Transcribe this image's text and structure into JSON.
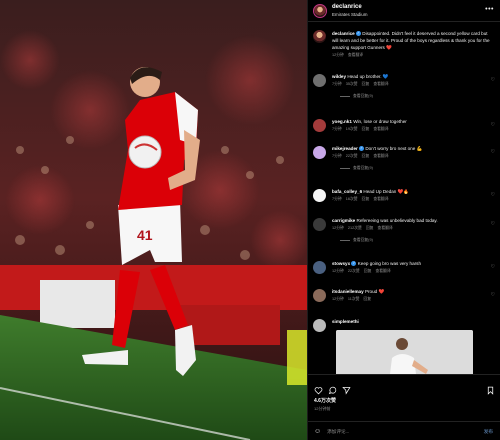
{
  "post": {
    "username": "declanrice",
    "location": "Emirates Stadium",
    "caption_user": "declanrice",
    "caption_text": "Disappointed. Didn't feel it deserved a second yellow card but will learn and be better for it. Proud of the boys regardless & thank you for the amazing support Gunners ❤️",
    "caption_time": "12分钟",
    "caption_translate": "查看翻译",
    "player_number": "41"
  },
  "comments": [
    {
      "user": "wildey",
      "text": "Head up brother. 💙",
      "time": "7分钟",
      "likes": "35次赞",
      "reply": "回复",
      "translate": "查看翻译",
      "view_replies": "查看回复(9)",
      "avatar_color": "#6f6f6f"
    },
    {
      "user": "yoeg.nk1",
      "text": "Win, lose or draw together",
      "time": "7分钟",
      "likes": "19次赞",
      "reply": "回复",
      "translate": "查看翻译",
      "view_replies": "",
      "avatar_color": "#a33b3b"
    },
    {
      "user": "mikejreader",
      "text": "Don't worry bro next one 💪",
      "time": "7分钟",
      "likes": "22次赞",
      "reply": "回复",
      "translate": "查看翻译",
      "view_replies": "查看回复(9)",
      "avatar_color": "#c8a8e8"
    },
    {
      "user": "bafa_colley_6",
      "text": "Head Up Dedan ❤️🔥",
      "time": "7分钟",
      "likes": "16次赞",
      "reply": "回复",
      "translate": "查看翻译",
      "view_replies": "",
      "avatar_color": "#f4f4f4"
    },
    {
      "user": "carrigmike",
      "text": "Refereeing was unbelievably bad today.",
      "time": "12分钟",
      "likes": "212次赞",
      "reply": "回复",
      "translate": "查看翻译",
      "view_replies": "查看回复(9)",
      "avatar_color": "#3a3a3a"
    },
    {
      "user": "stowsyx",
      "text": "Keep going bro was very harsh",
      "time": "12分钟",
      "likes": "22次赞",
      "reply": "回复",
      "translate": "查看翻译",
      "view_replies": "",
      "avatar_color": "#4a6080"
    },
    {
      "user": "itsdaniellemay",
      "text": "Proud ❤️",
      "time": "12分钟",
      "likes": "11次赞",
      "reply": "回复",
      "translate": "",
      "view_replies": "",
      "avatar_color": "#8a6a5a"
    },
    {
      "user": "simplemethi",
      "text": "",
      "time": "",
      "likes": "",
      "reply": "",
      "translate": "",
      "view_replies": "",
      "avatar_color": "#bbbbbb"
    }
  ],
  "footer": {
    "likes": "4.6万次赞",
    "time": "12分钟前",
    "input_placeholder": "添加评论...",
    "post_label": "发布"
  },
  "colors": {
    "verified": "#3897f0",
    "heart": "#ed4956",
    "arsenal_red": "#db0007"
  }
}
